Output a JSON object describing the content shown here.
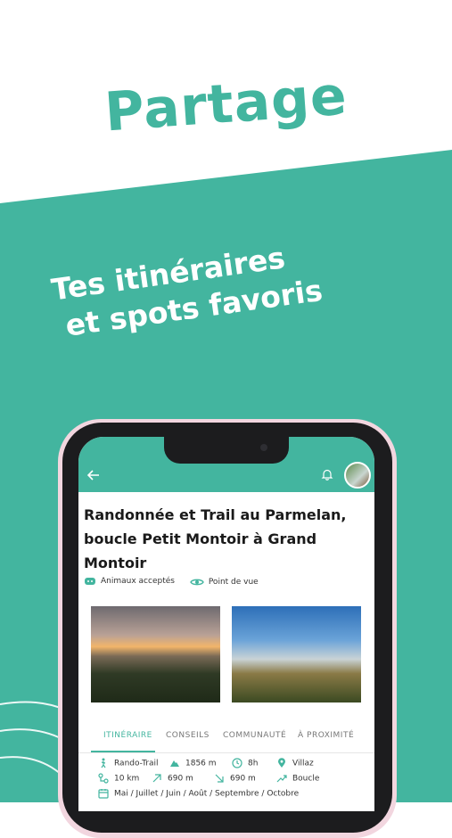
{
  "marketing": {
    "headline": "Partage",
    "subline_1": "Tes itinéraires",
    "subline_2": "et spots favoris"
  },
  "colors": {
    "accent": "#43b59f"
  },
  "app_bar": {
    "back_icon": "arrow-left-icon",
    "notification_icon": "bell-icon",
    "avatar": "user-avatar"
  },
  "route": {
    "title": "Randonnée et Trail au Parmelan, boucle Petit Montoir à Grand Montoir",
    "tags": [
      {
        "icon": "dog-icon",
        "label": "Animaux acceptés"
      },
      {
        "icon": "eye-icon",
        "label": "Point de vue"
      }
    ]
  },
  "tabs": [
    {
      "label": "ITINÉRAIRE",
      "active": true
    },
    {
      "label": "CONSEILS",
      "active": false
    },
    {
      "label": "COMMUNAUTÉ",
      "active": false
    },
    {
      "label": "À PROXIMITÉ",
      "active": false
    }
  ],
  "stats": {
    "activity": "Rando-Trail",
    "altitude": "1856 m",
    "duration": "8h",
    "location": "Villaz",
    "distance": "10 km",
    "elevation_gain": "690 m",
    "elevation_loss": "690 m",
    "route_type": "Boucle",
    "months": "Mai / Juillet / Juin / Août / Septembre / Octobre"
  }
}
